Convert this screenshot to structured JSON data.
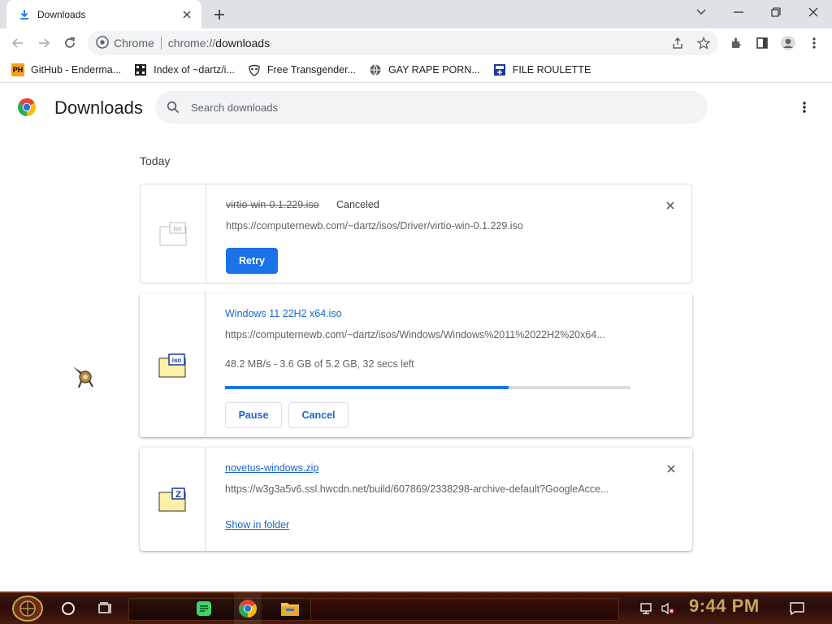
{
  "tab": {
    "title": "Downloads",
    "icon": "download-icon"
  },
  "toolbar": {
    "site_label": "Chrome",
    "url_prefix": "chrome://",
    "url_host": "downloads"
  },
  "bookmarks": [
    {
      "label": "GitHub - Enderma...",
      "icon": "ph-icon"
    },
    {
      "label": "Index of ~dartz/i...",
      "icon": "film-icon"
    },
    {
      "label": "Free Transgender...",
      "icon": "mask-icon"
    },
    {
      "label": "GAY RAPE PORN...",
      "icon": "globe-icon"
    },
    {
      "label": "FILE ROULETTE",
      "icon": "file-roulette-icon"
    }
  ],
  "page": {
    "title": "Downloads",
    "search_placeholder": "Search downloads"
  },
  "section_label": "Today",
  "downloads": [
    {
      "name": "virtio-win-0.1.229.iso",
      "status": "Canceled",
      "url": "https://computernewb.com/~dartz/isos/Driver/virtio-win-0.1.229.iso",
      "action": "Retry",
      "icon": "iso-file-icon"
    },
    {
      "name": "Windows 11 22H2 x64.iso",
      "url": "https://computernewb.com/~dartz/isos/Windows/Windows%2011%2022H2%20x64...",
      "progress_text": "48.2 MB/s - 3.6 GB of 5.2 GB, 32 secs left",
      "progress": 0.7,
      "pause_label": "Pause",
      "cancel_label": "Cancel",
      "icon": "iso-file-icon"
    },
    {
      "name": "novetus-windows.zip",
      "url": "https://w3g3a5v6.ssl.hwcdn.net/build/607869/2338298-archive-default?GoogleAcce...",
      "show_folder": "Show in folder",
      "icon": "zip-file-icon"
    }
  ],
  "taskbar": {
    "clock": "9:44 PM"
  },
  "colors": {
    "accent": "#1a73e8",
    "link": "#1967d2",
    "clock": "#c9a55b"
  }
}
